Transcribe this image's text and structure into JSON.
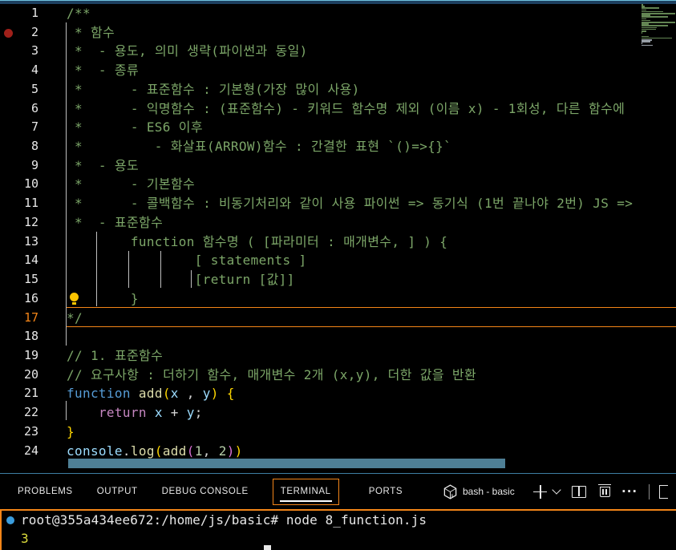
{
  "colors": {
    "background": "#000000",
    "contrast_border": "#6fc3df",
    "focus_border": "#f38518",
    "line_highlight_border": "#f38518",
    "scrollbar": "#4e7f95",
    "breakpoint_red": "#a0201a",
    "terminal_decoration_blue": "#3b9ddd",
    "line_number": "#e8e8e8",
    "active_line_number": "#f38518",
    "cm": "#7CA668",
    "kw": "#569CD6",
    "fn": "#DCDCAA",
    "vr": "#9CDCFE",
    "ct": "#C586C0",
    "nm": "#B5CEA8",
    "pl": "#D4D4D4",
    "b1": "#FFD700",
    "b2": "#DA70D6",
    "out": "#dcdc3c"
  },
  "editor": {
    "breakpoint_line": 2,
    "lightbulb_line": 16,
    "current_line": 17,
    "lines": [
      {
        "n": 1,
        "segs": [
          {
            "t": "/**",
            "c": "cm"
          }
        ]
      },
      {
        "n": 2,
        "segs": [
          {
            "t": " * 함수",
            "c": "cm"
          }
        ]
      },
      {
        "n": 3,
        "segs": [
          {
            "t": " *  - 용도, 의미 생략(파이썬과 동일)",
            "c": "cm"
          }
        ]
      },
      {
        "n": 4,
        "segs": [
          {
            "t": " *  - 종류",
            "c": "cm"
          }
        ]
      },
      {
        "n": 5,
        "segs": [
          {
            "t": " *      - 표준함수 : 기본형(가장 많이 사용)",
            "c": "cm"
          }
        ]
      },
      {
        "n": 6,
        "segs": [
          {
            "t": " *      - 익명함수 : (표준함수) - 키워드 함수명 제외 (이름 x) - 1회성, 다른 함수에",
            "c": "cm"
          }
        ]
      },
      {
        "n": 7,
        "segs": [
          {
            "t": " *      - ES6 이후",
            "c": "cm"
          }
        ]
      },
      {
        "n": 8,
        "segs": [
          {
            "t": " *         - 화살표(ARROW)함수 : 간결한 표현 `()=>{}`",
            "c": "cm"
          }
        ]
      },
      {
        "n": 9,
        "segs": [
          {
            "t": " *  - 용도",
            "c": "cm"
          }
        ]
      },
      {
        "n": 10,
        "segs": [
          {
            "t": " *      - 기본함수",
            "c": "cm"
          }
        ]
      },
      {
        "n": 11,
        "segs": [
          {
            "t": " *      - 콜백함수 : 비동기처리와 같이 사용 파이썬 => 동기식 (1번 끝나야 2번) JS =>",
            "c": "cm"
          }
        ]
      },
      {
        "n": 12,
        "segs": [
          {
            "t": " *  - 표준함수",
            "c": "cm"
          }
        ]
      },
      {
        "n": 13,
        "segs": [
          {
            "t": "        function 함수명 ( [파라미터 : 매개변수, ] ) {",
            "c": "cm"
          }
        ]
      },
      {
        "n": 14,
        "segs": [
          {
            "t": "                [ statements ]",
            "c": "cm"
          }
        ]
      },
      {
        "n": 15,
        "segs": [
          {
            "t": "                [return [값]]",
            "c": "cm"
          }
        ]
      },
      {
        "n": 16,
        "segs": [
          {
            "t": "        }",
            "c": "cm"
          }
        ]
      },
      {
        "n": 17,
        "segs": [
          {
            "t": "*/",
            "c": "cm"
          }
        ]
      },
      {
        "n": 18,
        "segs": []
      },
      {
        "n": 19,
        "segs": [
          {
            "t": "// 1. 표준함수",
            "c": "cm"
          }
        ]
      },
      {
        "n": 20,
        "segs": [
          {
            "t": "// 요구사항 : 더하기 함수, 매개변수 2개 (x,y), 더한 값을 반환",
            "c": "cm"
          }
        ]
      },
      {
        "n": 21,
        "segs": [
          {
            "t": "function",
            "c": "kw"
          },
          {
            "t": " ",
            "c": "pl"
          },
          {
            "t": "add",
            "c": "fn"
          },
          {
            "t": "(",
            "c": "b1"
          },
          {
            "t": "x",
            "c": "vr"
          },
          {
            "t": " , ",
            "c": "pl"
          },
          {
            "t": "y",
            "c": "vr"
          },
          {
            "t": ")",
            "c": "b1"
          },
          {
            "t": " ",
            "c": "pl"
          },
          {
            "t": "{",
            "c": "b1"
          }
        ]
      },
      {
        "n": 22,
        "segs": [
          {
            "t": "    ",
            "c": "pl"
          },
          {
            "t": "return",
            "c": "ct"
          },
          {
            "t": " ",
            "c": "pl"
          },
          {
            "t": "x",
            "c": "vr"
          },
          {
            "t": " + ",
            "c": "pl"
          },
          {
            "t": "y",
            "c": "vr"
          },
          {
            "t": ";",
            "c": "pl"
          }
        ]
      },
      {
        "n": 23,
        "segs": [
          {
            "t": "}",
            "c": "b1"
          }
        ]
      },
      {
        "n": 24,
        "segs": [
          {
            "t": "console",
            "c": "vr"
          },
          {
            "t": ".",
            "c": "pl"
          },
          {
            "t": "log",
            "c": "fn"
          },
          {
            "t": "(",
            "c": "b1"
          },
          {
            "t": "add",
            "c": "fn"
          },
          {
            "t": "(",
            "c": "b2"
          },
          {
            "t": "1",
            "c": "nm"
          },
          {
            "t": ", ",
            "c": "pl"
          },
          {
            "t": "2",
            "c": "nm"
          },
          {
            "t": ")",
            "c": "b2"
          },
          {
            "t": ")",
            "c": "b1"
          }
        ]
      }
    ]
  },
  "panel": {
    "tabs": [
      {
        "label": "PROBLEMS",
        "active": false
      },
      {
        "label": "OUTPUT",
        "active": false
      },
      {
        "label": "DEBUG CONSOLE",
        "active": false
      },
      {
        "label": "TERMINAL",
        "active": true
      },
      {
        "label": "PORTS",
        "active": false
      }
    ],
    "terminal_title": "bash - basic",
    "more_actions_glyph": "···"
  },
  "terminal": {
    "lines": [
      {
        "type": "command",
        "text": "root@355a434ee672:/home/js/basic# node 8_function.js",
        "decoration": "blue-dot"
      },
      {
        "type": "output",
        "text": "3"
      }
    ],
    "cursor_visible": true
  }
}
